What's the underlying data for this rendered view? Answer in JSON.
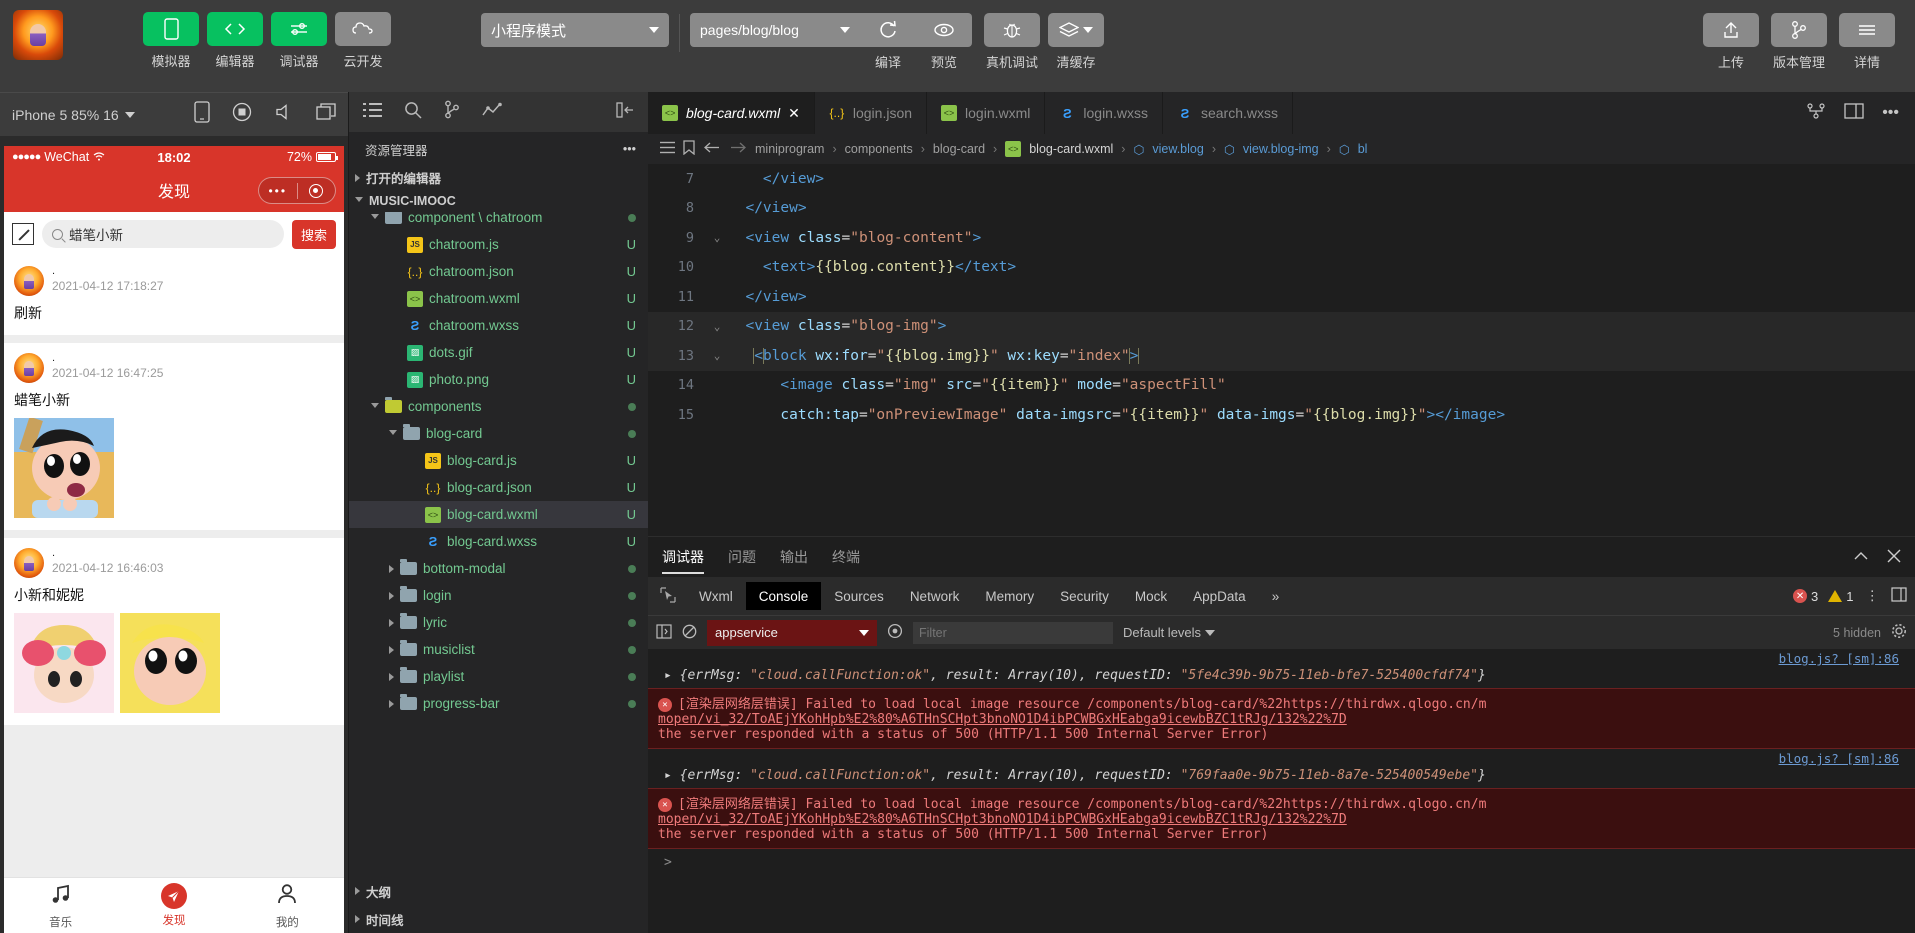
{
  "toolbar": {
    "avatar_name": "user-avatar",
    "buttons": [
      {
        "label": "模拟器",
        "icon": "phone-icon",
        "style": "green"
      },
      {
        "label": "编辑器",
        "icon": "code-icon",
        "style": "green"
      },
      {
        "label": "调试器",
        "icon": "sliders-icon",
        "style": "green"
      },
      {
        "label": "云开发",
        "icon": "cloud-icon",
        "style": "grey"
      }
    ],
    "mode_select": "小程序模式",
    "page_select": "pages/blog/blog",
    "actions": [
      {
        "label": "编译",
        "icon": "refresh-icon"
      },
      {
        "label": "预览",
        "icon": "eye-icon"
      },
      {
        "label": "真机调试",
        "icon": "bug-icon"
      },
      {
        "label": "清缓存",
        "icon": "layers-icon"
      }
    ],
    "right_actions": [
      {
        "label": "上传",
        "icon": "upload-icon"
      },
      {
        "label": "版本管理",
        "icon": "branch-icon"
      },
      {
        "label": "详情",
        "icon": "menu-icon"
      }
    ]
  },
  "simulator": {
    "device": "iPhone 5 85% 16",
    "toolbar_icons": [
      "phone-rotate-icon",
      "record-icon",
      "volume-icon",
      "window-icon"
    ],
    "status_bar": {
      "carrier": "WeChat",
      "signal_dots": "●●●●●",
      "wifi": "wifi-icon",
      "time": "18:02",
      "battery": "72%"
    },
    "nav_title": "发现",
    "search": {
      "value": "蜡笔小新",
      "button": "搜索",
      "icon": "search-icon",
      "compose_icon": "compose-icon"
    },
    "posts": [
      {
        "name": ".",
        "time": "2021-04-12 17:18:27",
        "content": "刷新",
        "images": []
      },
      {
        "name": ".",
        "time": "2021-04-12 16:47:25",
        "content": "蜡笔小新",
        "images": [
          "crayon-shinchan"
        ]
      },
      {
        "name": ".",
        "time": "2021-04-12 16:46:03",
        "content": "小新和妮妮",
        "images": [
          "nini",
          "shinchan2"
        ]
      }
    ],
    "tabbar": [
      {
        "label": "音乐",
        "icon": "music-note-icon",
        "active": false
      },
      {
        "label": "发现",
        "icon": "paper-plane-icon",
        "active": true
      },
      {
        "label": "我的",
        "icon": "person-icon",
        "active": false
      }
    ]
  },
  "explorer": {
    "activity_icons": [
      "explorer-icon",
      "search-icon",
      "source-control-icon",
      "debug-icon",
      "collapse-icon"
    ],
    "title": "资源管理器",
    "more_icon": "ellipsis-icon",
    "sections": [
      {
        "label": "打开的编辑器",
        "open": false
      },
      {
        "label": "MUSIC-IMOOC",
        "open": true
      }
    ],
    "tree": [
      {
        "label": "component \\ chatroom",
        "type": "folder-open",
        "indent": 1,
        "status": "dot",
        "clipped": true
      },
      {
        "label": "chatroom.js",
        "type": "js",
        "indent": 2,
        "status": "U"
      },
      {
        "label": "chatroom.json",
        "type": "json",
        "indent": 2,
        "status": "U"
      },
      {
        "label": "chatroom.wxml",
        "type": "wxml",
        "indent": 2,
        "status": "U"
      },
      {
        "label": "chatroom.wxss",
        "type": "wxss",
        "indent": 2,
        "status": "U"
      },
      {
        "label": "dots.gif",
        "type": "img",
        "indent": 2,
        "status": "U"
      },
      {
        "label": "photo.png",
        "type": "img",
        "indent": 2,
        "status": "U"
      },
      {
        "label": "components",
        "type": "folder-open-y",
        "indent": 1,
        "status": "dot"
      },
      {
        "label": "blog-card",
        "type": "folder-open",
        "indent": 2,
        "status": "dot"
      },
      {
        "label": "blog-card.js",
        "type": "js",
        "indent": 3,
        "status": "U"
      },
      {
        "label": "blog-card.json",
        "type": "json",
        "indent": 3,
        "status": "U"
      },
      {
        "label": "blog-card.wxml",
        "type": "wxml",
        "indent": 3,
        "status": "U",
        "selected": true
      },
      {
        "label": "blog-card.wxss",
        "type": "wxss",
        "indent": 3,
        "status": "U"
      },
      {
        "label": "bottom-modal",
        "type": "folder",
        "indent": 2,
        "status": "dot"
      },
      {
        "label": "login",
        "type": "folder",
        "indent": 2,
        "status": "dot"
      },
      {
        "label": "lyric",
        "type": "folder",
        "indent": 2,
        "status": "dot"
      },
      {
        "label": "musiclist",
        "type": "folder",
        "indent": 2,
        "status": "dot"
      },
      {
        "label": "playlist",
        "type": "folder",
        "indent": 2,
        "status": "dot"
      },
      {
        "label": "progress-bar",
        "type": "folder",
        "indent": 2,
        "status": "dot"
      }
    ],
    "footer_sections": [
      {
        "label": "大纲"
      },
      {
        "label": "时间线"
      }
    ]
  },
  "editor": {
    "tabs": [
      {
        "label": "blog-card.wxml",
        "icon": "wxml",
        "active": true,
        "closable": true
      },
      {
        "label": "login.json",
        "icon": "json",
        "active": false
      },
      {
        "label": "login.wxml",
        "icon": "wxml",
        "active": false
      },
      {
        "label": "login.wxss",
        "icon": "wxss",
        "active": false
      },
      {
        "label": "search.wxss",
        "icon": "wxss",
        "active": false
      }
    ],
    "tabs_right_icons": [
      "split-editor-icon",
      "layout-icon",
      "more-icon"
    ],
    "breadcrumb": {
      "icons": [
        "outline-icon",
        "bookmark-icon",
        "back-arrow-icon",
        "forward-arrow-icon"
      ],
      "path": [
        "miniprogram",
        "components",
        "blog-card",
        "blog-card.wxml",
        "view.blog",
        "view.blog-img",
        "bl"
      ]
    },
    "lines": [
      {
        "num": "7",
        "fold": "",
        "indent": 2,
        "html": "&lt;/view&gt;",
        "hl": false
      },
      {
        "num": "8",
        "fold": "",
        "indent": 1,
        "html": "&lt;/view&gt;",
        "hl": false
      },
      {
        "num": "9",
        "fold": "v",
        "indent": 1,
        "html": "&lt;view class=\"blog-content\"&gt;",
        "hl": false
      },
      {
        "num": "10",
        "fold": "",
        "indent": 2,
        "html": "&lt;text&gt;{{blog.content}}&lt;/text&gt;",
        "hl": false
      },
      {
        "num": "11",
        "fold": "",
        "indent": 1,
        "html": "&lt;/view&gt;",
        "hl": false
      },
      {
        "num": "12",
        "fold": "v",
        "indent": 1,
        "html": "&lt;view class=\"blog-img\"&gt;",
        "hl": true
      },
      {
        "num": "13",
        "fold": "v",
        "indent": 2,
        "html": "&lt;block wx:for=\"{{blog.img}}\" wx:key=\"index\"&gt;",
        "hl": true
      },
      {
        "num": "14",
        "fold": "",
        "indent": 3,
        "html": "&lt;image class=\"img\" src=\"{{item}}\" mode=\"aspectFill\"",
        "hl": false
      },
      {
        "num": "15",
        "fold": "",
        "indent": 3,
        "html": "catch:tap=\"onPreviewImage\" data-imgsrc=\"{{item}}\" data-imgs=\"{{blog.img}}\"&gt;&lt;/image&gt;",
        "hl": false
      }
    ]
  },
  "debugger": {
    "panel_tabs": [
      {
        "label": "调试器",
        "active": true
      },
      {
        "label": "问题",
        "active": false
      },
      {
        "label": "输出",
        "active": false
      },
      {
        "label": "终端",
        "active": false
      }
    ],
    "panel_right_icons": [
      "chevron-up-icon",
      "close-icon"
    ],
    "devtools_tabs": [
      {
        "label": "Wxml",
        "active": false
      },
      {
        "label": "Console",
        "active": true
      },
      {
        "label": "Sources",
        "active": false
      },
      {
        "label": "Network",
        "active": false
      },
      {
        "label": "Memory",
        "active": false
      },
      {
        "label": "Security",
        "active": false
      },
      {
        "label": "Mock",
        "active": false
      },
      {
        "label": "AppData",
        "active": false
      }
    ],
    "more_tabs_icon": "chevron-right-right-icon",
    "inspect_icon": "inspect-cursor-icon",
    "error_count": "3",
    "warning_count": "1",
    "right_icons": [
      "kebab-menu-icon",
      "dock-icon"
    ],
    "filter_bar": {
      "sidebar_icon": "console-sidebar-icon",
      "clear_icon": "clear-console-icon",
      "context": "appservice",
      "eye_icon": "eye-icon",
      "filter_placeholder": "Filter",
      "levels": "Default levels",
      "hidden": "5 hidden",
      "settings_icon": "gear-icon"
    },
    "console_entries": [
      {
        "type": "log",
        "source": "blog.js? [sm]:86",
        "prefix": "{errMsg: ",
        "q1": "\"cloud.callFunction:ok\"",
        "mid": ", result: Array(10), requestID: ",
        "q2": "\"5fe4c39b-9b75-11eb-bfe7-525400cfdf74\"",
        "suffix": "}"
      },
      {
        "type": "error",
        "line1": "[渲染层网络层错误] Failed to load local image resource /components/blog-card/%22https://thirdwx.qlogo.cn/m",
        "line2": "mopen/vi_32/ToAEjYKohHpb%E2%80%A6THnSCHpt3bnoNO1D4ibPCWBGxHEabga9icewbBZC1tRJg/132%22%7D",
        "line3": "the server responded with a status of 500 (HTTP/1.1 500 Internal Server Error)"
      },
      {
        "type": "log",
        "source": "blog.js? [sm]:86",
        "prefix": "{errMsg: ",
        "q1": "\"cloud.callFunction:ok\"",
        "mid": ", result: Array(10), requestID: ",
        "q2": "\"769faa0e-9b75-11eb-8a7e-525400549ebe\"",
        "suffix": "}"
      },
      {
        "type": "error",
        "line1": "[渲染层网络层错误] Failed to load local image resource /components/blog-card/%22https://thirdwx.qlogo.cn/m",
        "line2": "mopen/vi_32/ToAEjYKohHpb%E2%80%A6THnSCHpt3bnoNO1D4ibPCWBGxHEabga9icewbBZC1tRJg/132%22%7D",
        "line3": "the server responded with a status of 500 (HTTP/1.1 500 Internal Server Error)"
      }
    ],
    "prompt": ">"
  },
  "colors": {
    "accent_green": "#07c160",
    "wechat_red": "#d8352a",
    "error_red": "#d9534f",
    "tree_green": "#73c991"
  }
}
